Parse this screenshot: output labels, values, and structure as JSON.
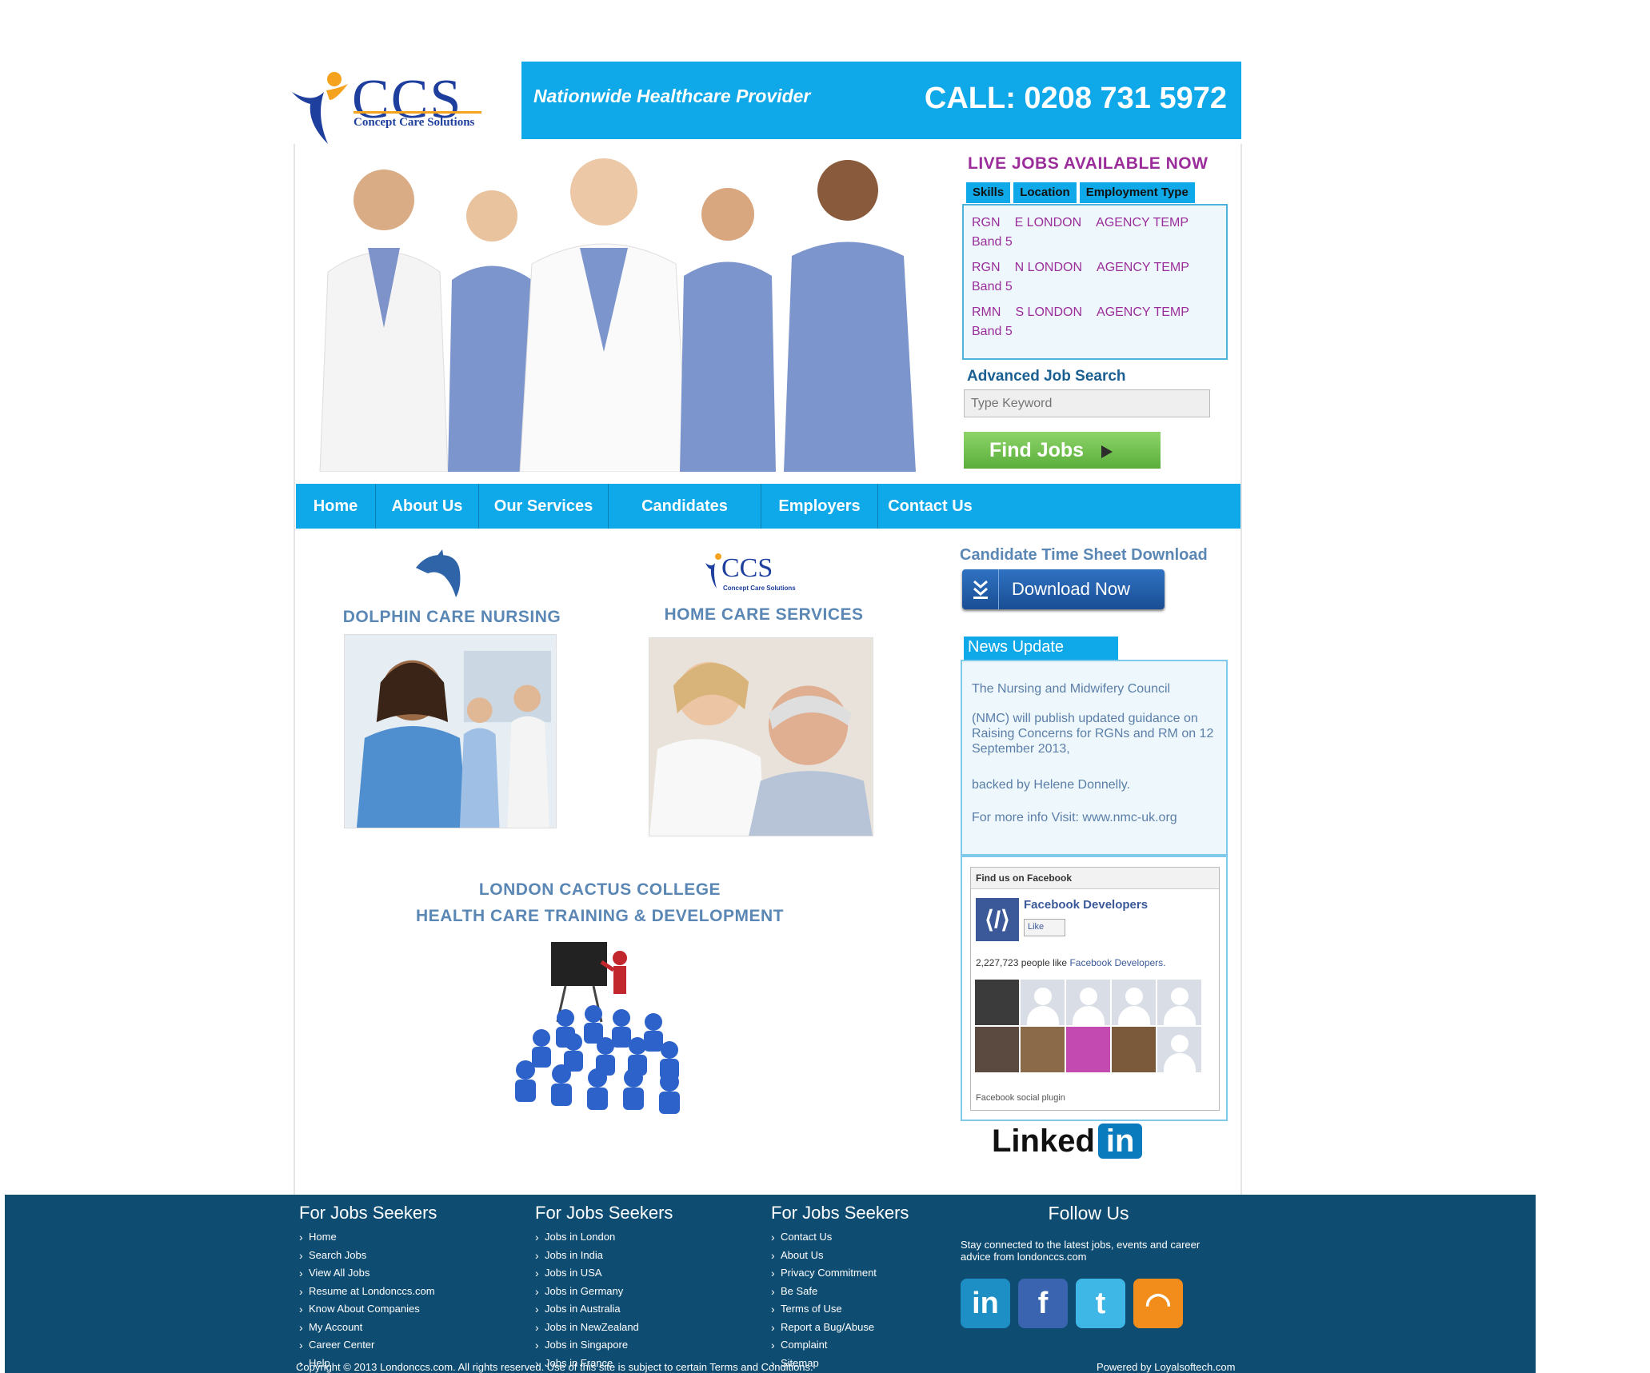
{
  "header": {
    "logo_text": "CCS",
    "logo_tagline": "Concept Care Solutions",
    "tagline": "Nationwide Healthcare Provider",
    "call": "CALL: 0208 731 5972"
  },
  "live_jobs": {
    "title": "LIVE JOBS AVAILABLE NOW",
    "tabs": [
      "Skills",
      "Location",
      "Employment Type"
    ],
    "jobs": [
      {
        "skill": "RGN",
        "location": "E LONDON",
        "type": "AGENCY TEMP",
        "band": "Band 5"
      },
      {
        "skill": "RGN",
        "location": "N LONDON",
        "type": "AGENCY TEMP",
        "band": "Band 5"
      },
      {
        "skill": "RMN",
        "location": "S LONDON",
        "type": "AGENCY TEMP",
        "band": "Band 5"
      }
    ]
  },
  "search": {
    "title": "Advanced Job Search",
    "placeholder": "Type Keyword",
    "button": "Find Jobs"
  },
  "nav": [
    "Home",
    "About Us",
    "Our Services",
    "Candidates",
    "Employers",
    "Contact Us"
  ],
  "sections": {
    "dolphin": "DOLPHIN CARE NURSING",
    "homecare": "HOME CARE SERVICES",
    "homecare_logo_text": "CCS",
    "homecare_logo_tagline": "Concept Care Solutions",
    "college_line1": "LONDON CACTUS COLLEGE",
    "college_line2": "HEALTH CARE TRAINING & DEVELOPMENT"
  },
  "timesheet": {
    "title": "Candidate Time Sheet Download",
    "button": "Download Now"
  },
  "news": {
    "title": "News Update",
    "paragraphs": [
      "The Nursing and Midwifery Council",
      "(NMC) will publish updated guidance on Raising Concerns for RGNs and RM on 12 September 2013,",
      "backed by Helene Donnelly.",
      "For more info Visit:  www.nmc-uk.org"
    ]
  },
  "facebook": {
    "header": "Find us on Facebook",
    "page_name": "Facebook Developers",
    "like": "Like",
    "count_text": "2,227,723 people like",
    "count_link": "Facebook Developers.",
    "plugin": "Facebook social plugin"
  },
  "linkedin": {
    "word": "Linked",
    "in": "in"
  },
  "footer": {
    "col1": {
      "title": "For Jobs Seekers",
      "items": [
        "Home",
        "Search Jobs",
        "View All Jobs",
        "Resume at Londonccs.com",
        "Know About Companies",
        "My Account",
        "Career Center",
        "Help"
      ]
    },
    "col2": {
      "title": "For Jobs Seekers",
      "items": [
        "Jobs in London",
        "Jobs in India",
        "Jobs in USA",
        "Jobs in Germany",
        "Jobs in Australia",
        "Jobs in NewZealand",
        "Jobs in Singapore",
        "Jobs in France"
      ]
    },
    "col3": {
      "title": "For Jobs Seekers",
      "items": [
        "Contact Us",
        "About Us",
        "Privacy Commitment",
        "Be Safe",
        "Terms of Use",
        "Report a Bug/Abuse",
        "Complaint",
        "Sitemap"
      ]
    },
    "follow": {
      "title": "Follow Us",
      "text": "Stay connected to the latest jobs, events and career advice from londonccs.com"
    },
    "social": [
      {
        "name": "linkedin-icon",
        "glyph": "in",
        "color": "#1d8fc4"
      },
      {
        "name": "facebook-icon",
        "glyph": "f",
        "color": "#3b64b0"
      },
      {
        "name": "twitter-icon",
        "glyph": "t",
        "color": "#3fb7e6"
      },
      {
        "name": "rss-icon",
        "glyph": "◠",
        "color": "#f28d1c"
      }
    ],
    "copyright": "Copyright © 2013 Londonccs.com. All rights reserved. Use of this site is subject to certain Terms and Conditions.",
    "powered": "Powered by Loyalsoftech.com"
  }
}
